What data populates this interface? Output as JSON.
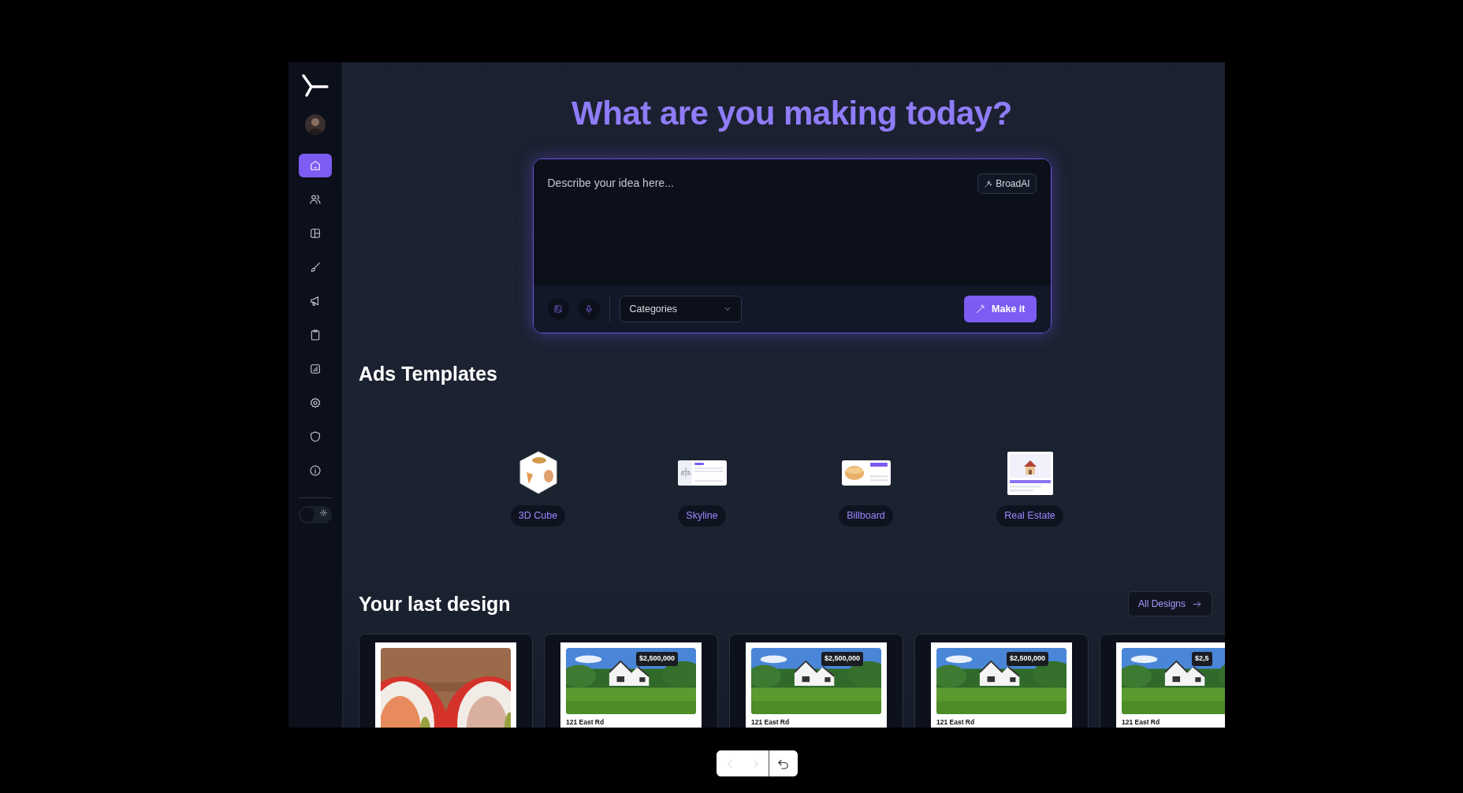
{
  "sidebar": {
    "items": [
      {
        "selected": true
      },
      {
        "selected": false
      },
      {
        "selected": false
      },
      {
        "selected": false
      },
      {
        "selected": false
      },
      {
        "selected": false
      },
      {
        "selected": false
      },
      {
        "selected": false
      },
      {
        "selected": false
      },
      {
        "selected": false
      }
    ]
  },
  "theme_toggle": {
    "on": false
  },
  "heading": "What are you making today?",
  "prompt": {
    "placeholder": "Describe your idea here...",
    "model_button": "BroadAI",
    "category_select": "Categories",
    "submit_button": "Make it"
  },
  "ads_templates": {
    "title": "Ads Templates",
    "items": [
      {
        "kind": "cube",
        "label": "3D Cube"
      },
      {
        "kind": "scale_card",
        "label": "Skyline"
      },
      {
        "kind": "food_card",
        "label": "Billboard"
      },
      {
        "kind": "house_card",
        "label": "Real Estate"
      }
    ]
  },
  "last_design": {
    "title": "Your last design",
    "all_button": "All Designs",
    "items": [
      {
        "kind": "picture"
      },
      {
        "kind": "listing",
        "price": "$2,500,000",
        "address": "121 East Rd"
      },
      {
        "kind": "listing",
        "price": "$2,500,000",
        "address": "121 East Rd"
      },
      {
        "kind": "listing",
        "price": "$2,500,000",
        "address": "121 East Rd"
      },
      {
        "kind": "listing",
        "price": "$2,5",
        "address": "121 East Rd"
      }
    ]
  },
  "pager": {
    "back_disabled": true,
    "forward_disabled": true
  }
}
